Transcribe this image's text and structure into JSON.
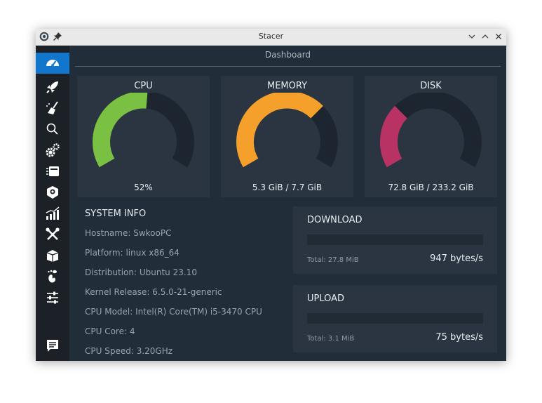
{
  "window": {
    "title": "Stacer"
  },
  "colors": {
    "cpu_arc": "#7ac143",
    "memory_arc": "#f4a02a",
    "disk_arc": "#b83263",
    "track": "#1d2630",
    "active_sidebar": "#1177cc"
  },
  "sidebar": {
    "items": [
      {
        "icon": "dashboard-icon",
        "active": true
      },
      {
        "icon": "rocket-icon"
      },
      {
        "icon": "broom-icon"
      },
      {
        "icon": "search-icon"
      },
      {
        "icon": "gears-icon"
      },
      {
        "icon": "package-icon"
      },
      {
        "icon": "resources-icon"
      },
      {
        "icon": "chart-icon"
      },
      {
        "icon": "tools-icon"
      },
      {
        "icon": "box-icon"
      },
      {
        "icon": "gnome-icon"
      },
      {
        "icon": "sliders-icon"
      },
      {
        "icon": "feedback-icon"
      }
    ]
  },
  "dashboard": {
    "title": "Dashboard",
    "cpu": {
      "title": "CPU",
      "value": "52%",
      "percent": 52
    },
    "memory": {
      "title": "MEMORY",
      "value": "5.3 GiB / 7.7 GiB",
      "percent": 68.8
    },
    "disk": {
      "title": "DISK",
      "value": "72.8 GiB / 233.2 GiB",
      "percent": 31.2
    }
  },
  "system_info": {
    "title": "SYSTEM INFO",
    "lines": [
      "Hostname: SwkooPC",
      "Platform: linux x86_64",
      "Distribution: Ubuntu 23.10",
      "Kernel Release: 6.5.0-21-generic",
      "CPU Model: Intel(R) Core(TM) i5-3470 CPU",
      "CPU Core: 4",
      "CPU Speed: 3.20GHz"
    ]
  },
  "download": {
    "title": "DOWNLOAD",
    "total": "Total: 27.8 MiB",
    "rate": "947 bytes/s"
  },
  "upload": {
    "title": "UPLOAD",
    "total": "Total: 3.1 MiB",
    "rate": "75 bytes/s"
  }
}
